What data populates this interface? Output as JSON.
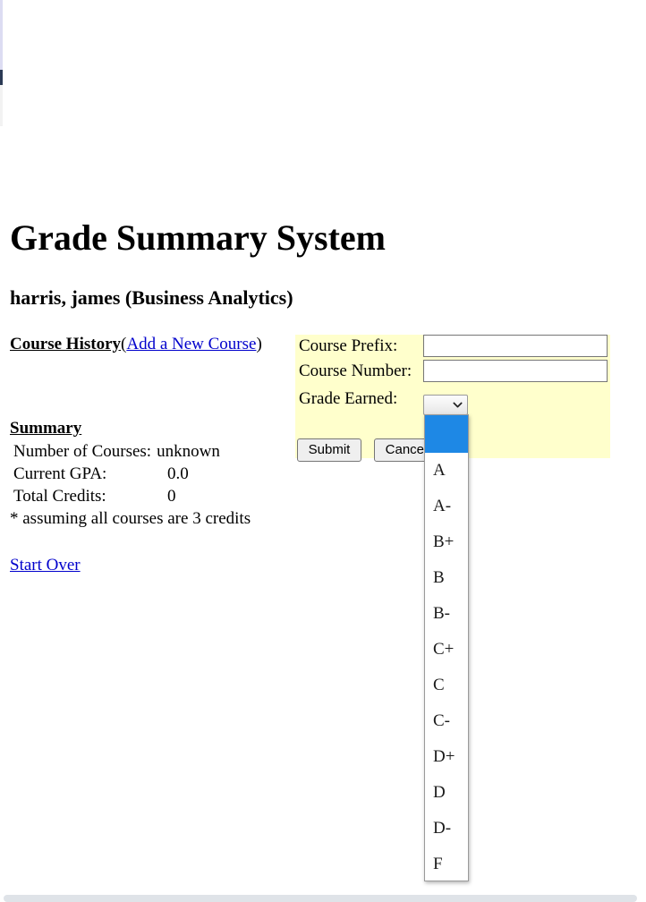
{
  "page": {
    "title": "Grade Summary System",
    "student_line": "harris, james (Business Analytics)"
  },
  "course_history": {
    "heading": "Course History",
    "open_paren": "(",
    "add_course_link": "Add a New Course",
    "close_paren": ")"
  },
  "summary": {
    "heading": "Summary",
    "rows": [
      {
        "label": "Number of Courses:",
        "value": "unknown"
      },
      {
        "label": "Current GPA:",
        "value": "0.0"
      },
      {
        "label": "Total Credits:",
        "value": "0"
      }
    ],
    "note": "* assuming all courses are 3 credits"
  },
  "start_over_link": "Start Over",
  "form": {
    "prefix_label": "Course Prefix:",
    "prefix_value": "",
    "prefix_placeholder": "",
    "number_label": "Course Number:",
    "number_value": "",
    "number_placeholder": "",
    "grade_label": "Grade Earned:",
    "grade_selected": "",
    "submit_label": "Submit",
    "cancel_label": "Cancel",
    "panel_color": "#ffffcc"
  },
  "grade_dropdown": {
    "open": true,
    "highlight_color": "#1e88e5",
    "selected_index": 0,
    "options": [
      "",
      "A",
      "A-",
      "B+",
      "B",
      "B-",
      "C+",
      "C",
      "C-",
      "D+",
      "D",
      "D-",
      "F"
    ]
  },
  "icons": {
    "chevron_down": "chevron-down-icon"
  }
}
